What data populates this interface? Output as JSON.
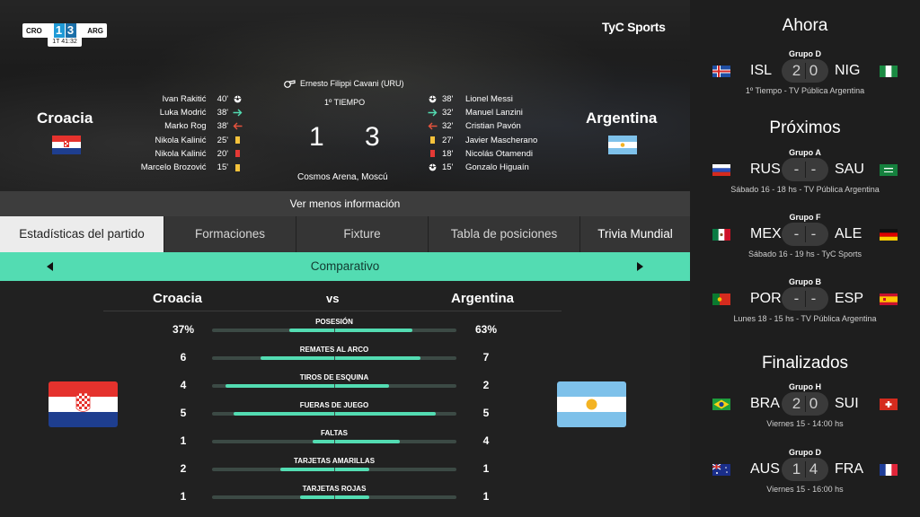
{
  "hero": {
    "brand": "TyC Sports",
    "mini_score": {
      "home_code": "CRO",
      "home_score": "1",
      "away_score": "3",
      "away_code": "ARG",
      "clock": "1T 41:32"
    },
    "home_team": "Croacia",
    "away_team": "Argentina",
    "referee": "Ernesto Filippi Cavani (URU)",
    "half": "1º TIEMPO",
    "score_home": "1",
    "score_away": "3",
    "stadium": "Cosmos Arena, Moscú",
    "home_events": [
      {
        "player": "Ivan Rakitić",
        "minute": "40'",
        "icon": "ball-icon"
      },
      {
        "player": "Luka Modrić",
        "minute": "38'",
        "icon": "sub-in-icon"
      },
      {
        "player": "Marko Rog",
        "minute": "38'",
        "icon": "sub-out-icon"
      },
      {
        "player": "Nikola Kalinić",
        "minute": "25'",
        "icon": "yellow-card-icon"
      },
      {
        "player": "Nikola Kalinić",
        "minute": "20'",
        "icon": "red-card-icon"
      },
      {
        "player": "Marcelo Brozović",
        "minute": "15'",
        "icon": "yellow-card-icon"
      }
    ],
    "away_events": [
      {
        "player": "Lionel Messi",
        "minute": "38'",
        "icon": "ball-icon"
      },
      {
        "player": "Manuel Lanzini",
        "minute": "32'",
        "icon": "sub-in-icon"
      },
      {
        "player": "Cristian Pavón",
        "minute": "32'",
        "icon": "sub-out-icon"
      },
      {
        "player": "Javier Mascherano",
        "minute": "27'",
        "icon": "yellow-card-icon"
      },
      {
        "player": "Nicolás Otamendi",
        "minute": "18'",
        "icon": "red-card-icon"
      },
      {
        "player": "Gonzalo Higuaín",
        "minute": "15'",
        "icon": "ball-icon"
      }
    ]
  },
  "info_bar": "Ver menos información",
  "tabs": [
    {
      "label": "Estadísticas del partido",
      "active": true
    },
    {
      "label": "Formaciones",
      "active": false
    },
    {
      "label": "Fixture",
      "active": false
    },
    {
      "label": "Tabla de posiciones",
      "active": false
    },
    {
      "label": "Trivia Mundial",
      "active": false
    }
  ],
  "comparativo": {
    "label": "Comparativo",
    "home": "Croacia",
    "vs": "vs",
    "away": "Argentina",
    "stats": [
      {
        "label": "POSESIÓN",
        "home": "37%",
        "away": "63%",
        "home_frac": 0.37,
        "away_frac": 0.63
      },
      {
        "label": "REMATES AL ARCO",
        "home": "6",
        "away": "7",
        "home_frac": 0.6,
        "away_frac": 0.7
      },
      {
        "label": "TIROS DE ESQUINA",
        "home": "4",
        "away": "2",
        "home_frac": 0.89,
        "away_frac": 0.44
      },
      {
        "label": "FUERAS DE JUEGO",
        "home": "5",
        "away": "5",
        "home_frac": 0.82,
        "away_frac": 0.82
      },
      {
        "label": "FALTAS",
        "home": "1",
        "away": "4",
        "home_frac": 0.18,
        "away_frac": 0.53
      },
      {
        "label": "TARJETAS AMARILLAS",
        "home": "2",
        "away": "1",
        "home_frac": 0.44,
        "away_frac": 0.28
      },
      {
        "label": "TARJETAS ROJAS",
        "home": "1",
        "away": "1",
        "home_frac": 0.28,
        "away_frac": 0.28
      }
    ]
  },
  "sidebar": {
    "now_title": "Ahora",
    "upcoming_title": "Próximos",
    "finished_title": "Finalizados",
    "now": [
      {
        "group": "Grupo D",
        "home": "ISL",
        "away": "NIG",
        "hs": "2",
        "as": "0",
        "info": "1º Tiempo - TV Pública Argentina",
        "hflag": "iceland",
        "aflag": "nigeria"
      }
    ],
    "upcoming": [
      {
        "group": "Grupo A",
        "home": "RUS",
        "away": "SAU",
        "hs": "-",
        "as": "-",
        "info": "Sábado 16 - 18 hs - TV Pública Argentina",
        "hflag": "russia",
        "aflag": "saudi"
      },
      {
        "group": "Grupo F",
        "home": "MEX",
        "away": "ALE",
        "hs": "-",
        "as": "-",
        "info": "Sábado 16 - 19 hs - TyC Sports",
        "hflag": "mexico",
        "aflag": "germany"
      },
      {
        "group": "Grupo B",
        "home": "POR",
        "away": "ESP",
        "hs": "-",
        "as": "-",
        "info": "Lunes 18 - 15 hs - TV Pública Argentina",
        "hflag": "portugal",
        "aflag": "spain"
      }
    ],
    "finished": [
      {
        "group": "Grupo H",
        "home": "BRA",
        "away": "SUI",
        "hs": "2",
        "as": "0",
        "info": "Viernes 15 - 14:00 hs",
        "hflag": "brazil",
        "aflag": "switzerland"
      },
      {
        "group": "Grupo D",
        "home": "AUS",
        "away": "FRA",
        "hs": "1",
        "as": "4",
        "info": "Viernes 15 - 16:00 hs",
        "hflag": "australia",
        "aflag": "france"
      }
    ]
  },
  "colors": {
    "accent": "#53dcb2",
    "bar_track": "#3c4a45",
    "sidebar_bg": "#1e1e1e"
  }
}
